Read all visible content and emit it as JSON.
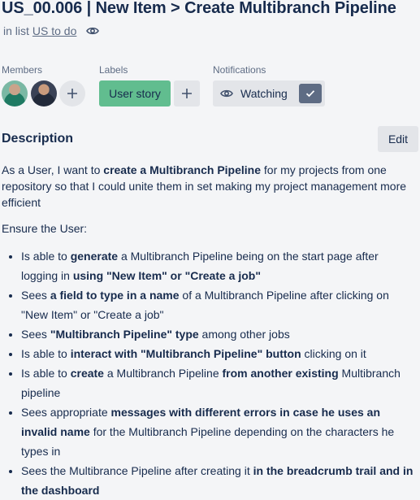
{
  "card": {
    "title": "US_00.006 | New Item > Create Multibranch Pipeline",
    "in_list_prefix": "in list",
    "list_name": "US to do"
  },
  "members": {
    "label": "Members"
  },
  "labels": {
    "label": "Labels",
    "chip": "User story",
    "chip_color": "#61bd8f"
  },
  "notifications": {
    "label": "Notifications",
    "watch_label": "Watching"
  },
  "description": {
    "heading": "Description",
    "edit_label": "Edit",
    "intro": [
      {
        "t": "As a User, I want to "
      },
      {
        "t": "create a Multibranch Pipeline",
        "b": true
      },
      {
        "t": " for my projects from one repository so that I could unite them in set making my project management more efficient"
      }
    ],
    "ensure": "Ensure the User:",
    "bullets": [
      [
        {
          "t": "Is able to "
        },
        {
          "t": "generate",
          "b": true
        },
        {
          "t": " a Multibranch Pipeline being on the start page after logging in "
        },
        {
          "t": "using \"New Item\" or \"Create a job\"",
          "b": true
        }
      ],
      [
        {
          "t": "Sees "
        },
        {
          "t": "a field to type in a name",
          "b": true
        },
        {
          "t": " of a Multibranch Pipeline after clicking on \"New Item\" or \"Create a job\""
        }
      ],
      [
        {
          "t": "Sees "
        },
        {
          "t": "\"Multibranch Pipeline\" type",
          "b": true
        },
        {
          "t": " among other jobs"
        }
      ],
      [
        {
          "t": "Is able to "
        },
        {
          "t": "interact with \"Multibranch Pipeline\" button",
          "b": true
        },
        {
          "t": " clicking on it"
        }
      ],
      [
        {
          "t": "Is able to "
        },
        {
          "t": "create",
          "b": true
        },
        {
          "t": " a Multibranch Pipeline "
        },
        {
          "t": "from another existing",
          "b": true
        },
        {
          "t": " Multibranch pipeline"
        }
      ],
      [
        {
          "t": "Sees appropriate "
        },
        {
          "t": "messages with different errors in case he uses an invalid name",
          "b": true
        },
        {
          "t": " for the Multibranch Pipeline depending on the characters he types in"
        }
      ],
      [
        {
          "t": "Sees the Multibrance Pipeline after creating it "
        },
        {
          "t": "in the breadcrumb trail and in the dashboard",
          "b": true
        }
      ]
    ]
  }
}
